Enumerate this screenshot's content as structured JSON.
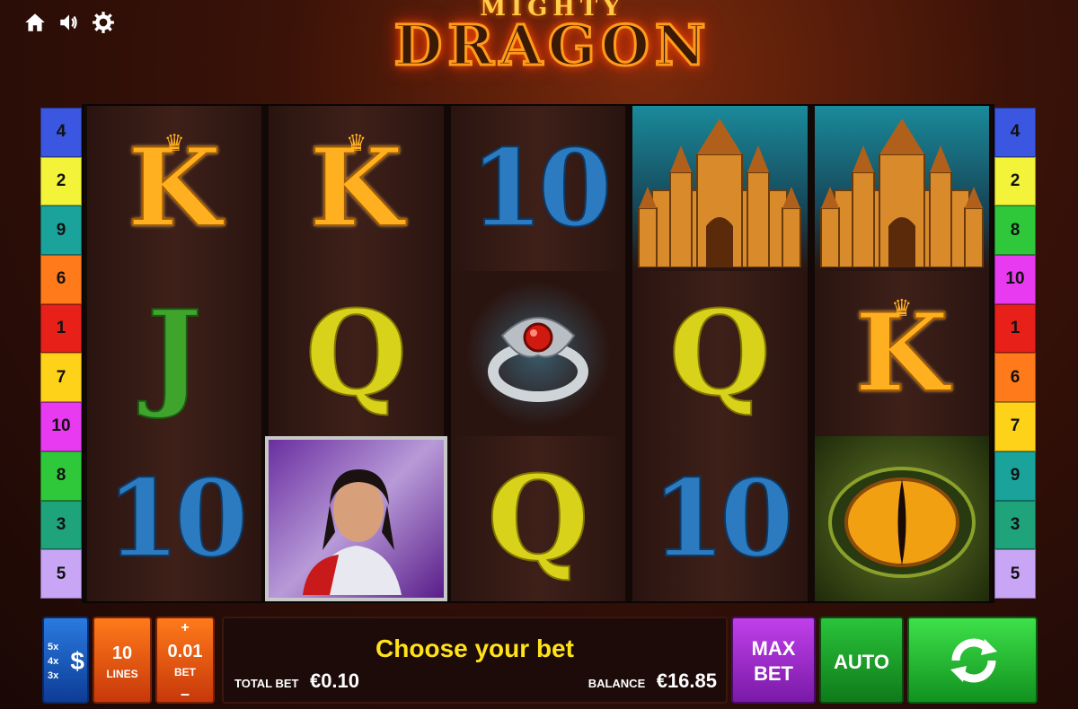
{
  "logo": {
    "top": "MIGHTY",
    "main": "DRAGON"
  },
  "icons": [
    "home-icon",
    "speaker-icon",
    "gear-icon"
  ],
  "paylines_left": [
    {
      "n": "4",
      "color": "#3b56e0"
    },
    {
      "n": "2",
      "color": "#f3f33a"
    },
    {
      "n": "9",
      "color": "#1aa39a"
    },
    {
      "n": "6",
      "color": "#ff7a1a"
    },
    {
      "n": "1",
      "color": "#e8201a"
    },
    {
      "n": "7",
      "color": "#ffd21a"
    },
    {
      "n": "10",
      "color": "#e83af0"
    },
    {
      "n": "8",
      "color": "#2fc83a"
    },
    {
      "n": "3",
      "color": "#1fa37a"
    },
    {
      "n": "5",
      "color": "#c8a6f5"
    }
  ],
  "paylines_right": [
    {
      "n": "4",
      "color": "#3b56e0"
    },
    {
      "n": "2",
      "color": "#f3f33a"
    },
    {
      "n": "8",
      "color": "#2fc83a"
    },
    {
      "n": "10",
      "color": "#e83af0"
    },
    {
      "n": "1",
      "color": "#e8201a"
    },
    {
      "n": "6",
      "color": "#ff7a1a"
    },
    {
      "n": "7",
      "color": "#ffd21a"
    },
    {
      "n": "9",
      "color": "#1aa39a"
    },
    {
      "n": "3",
      "color": "#1fa37a"
    },
    {
      "n": "5",
      "color": "#c8a6f5"
    }
  ],
  "reels": [
    [
      "K",
      "K",
      "10",
      "castle",
      "castle"
    ],
    [
      "J",
      "Q",
      "ring",
      "Q",
      "K"
    ],
    [
      "10",
      "knight",
      "Q",
      "10",
      "eye"
    ]
  ],
  "controls": {
    "paytable_multipliers": [
      "5x",
      "4x",
      "3x"
    ],
    "paytable_symbol": "$",
    "lines_value": "10",
    "lines_label": "LINES",
    "bet_value": "0.01",
    "bet_label": "BET",
    "bet_plus": "+",
    "bet_minus": "–",
    "message": "Choose your bet",
    "total_bet_label": "TOTAL BET",
    "total_bet_value": "€0.10",
    "balance_label": "BALANCE",
    "balance_value": "€16.85",
    "max_bet_line1": "MAX",
    "max_bet_line2": "BET",
    "auto_label": "AUTO"
  }
}
